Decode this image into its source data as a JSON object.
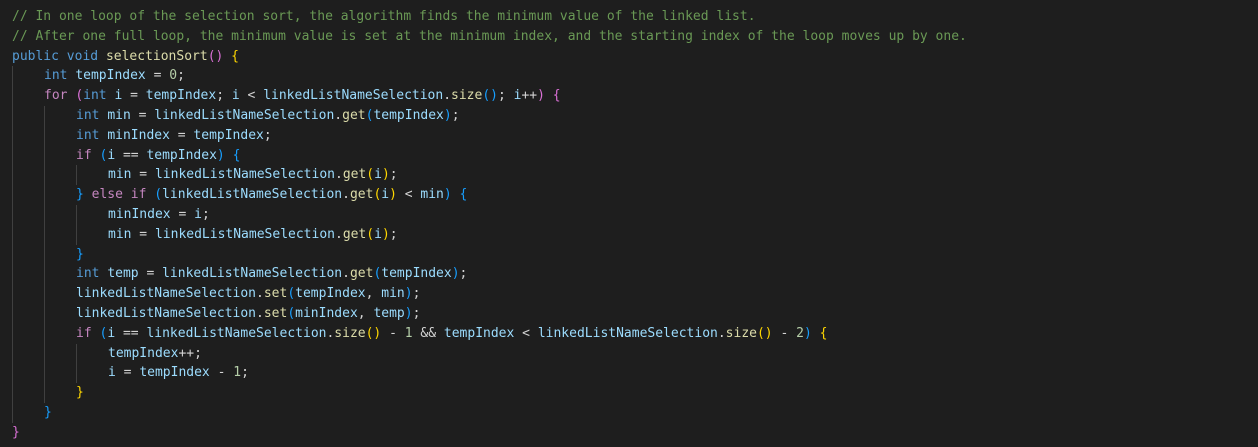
{
  "theme": {
    "background": "#1e1e1e",
    "comment": "#6a9955",
    "keyword": "#569cd6",
    "control": "#c586c0",
    "method": "#dcdcaa",
    "variable": "#9cdcfe",
    "number": "#b5cea8",
    "plain": "#d4d4d4",
    "bracket1": "#ffd700",
    "bracket2": "#da70d6",
    "bracket3": "#179fff"
  },
  "code": {
    "lines": [
      {
        "indent": 0,
        "tokens": [
          {
            "t": "// In one loop of the selection sort, the algorithm finds the minimum value of the linked list.",
            "c": "comment"
          }
        ]
      },
      {
        "indent": 0,
        "tokens": [
          {
            "t": "// After one full loop, the minimum value is set at the minimum index, and the starting index of the loop moves up by one.",
            "c": "comment"
          }
        ]
      },
      {
        "indent": 0,
        "tokens": [
          {
            "t": "public",
            "c": "keyword"
          },
          {
            "t": " ",
            "c": "plain"
          },
          {
            "t": "void",
            "c": "keyword"
          },
          {
            "t": " ",
            "c": "plain"
          },
          {
            "t": "selectionSort",
            "c": "method"
          },
          {
            "t": "()",
            "c": "bracket2"
          },
          {
            "t": " ",
            "c": "plain"
          },
          {
            "t": "{",
            "c": "bracket1"
          }
        ]
      },
      {
        "indent": 1,
        "tokens": [
          {
            "t": "int",
            "c": "keyword"
          },
          {
            "t": " ",
            "c": "plain"
          },
          {
            "t": "tempIndex",
            "c": "variable"
          },
          {
            "t": " = ",
            "c": "plain"
          },
          {
            "t": "0",
            "c": "number"
          },
          {
            "t": ";",
            "c": "plain"
          }
        ]
      },
      {
        "indent": 1,
        "tokens": [
          {
            "t": "for",
            "c": "control"
          },
          {
            "t": " ",
            "c": "plain"
          },
          {
            "t": "(",
            "c": "bracket2"
          },
          {
            "t": "int",
            "c": "keyword"
          },
          {
            "t": " ",
            "c": "plain"
          },
          {
            "t": "i",
            "c": "variable"
          },
          {
            "t": " = ",
            "c": "plain"
          },
          {
            "t": "tempIndex",
            "c": "variable"
          },
          {
            "t": "; ",
            "c": "plain"
          },
          {
            "t": "i",
            "c": "variable"
          },
          {
            "t": " < ",
            "c": "plain"
          },
          {
            "t": "linkedListNameSelection",
            "c": "variable"
          },
          {
            "t": ".",
            "c": "plain"
          },
          {
            "t": "size",
            "c": "method"
          },
          {
            "t": "()",
            "c": "bracket3"
          },
          {
            "t": "; ",
            "c": "plain"
          },
          {
            "t": "i",
            "c": "variable"
          },
          {
            "t": "++",
            "c": "plain"
          },
          {
            "t": ")",
            "c": "bracket2"
          },
          {
            "t": " ",
            "c": "plain"
          },
          {
            "t": "{",
            "c": "bracket2"
          }
        ]
      },
      {
        "indent": 2,
        "tokens": [
          {
            "t": "int",
            "c": "keyword"
          },
          {
            "t": " ",
            "c": "plain"
          },
          {
            "t": "min",
            "c": "variable"
          },
          {
            "t": " = ",
            "c": "plain"
          },
          {
            "t": "linkedListNameSelection",
            "c": "variable"
          },
          {
            "t": ".",
            "c": "plain"
          },
          {
            "t": "get",
            "c": "method"
          },
          {
            "t": "(",
            "c": "bracket3"
          },
          {
            "t": "tempIndex",
            "c": "variable"
          },
          {
            "t": ")",
            "c": "bracket3"
          },
          {
            "t": ";",
            "c": "plain"
          }
        ]
      },
      {
        "indent": 2,
        "tokens": [
          {
            "t": "int",
            "c": "keyword"
          },
          {
            "t": " ",
            "c": "plain"
          },
          {
            "t": "minIndex",
            "c": "variable"
          },
          {
            "t": " = ",
            "c": "plain"
          },
          {
            "t": "tempIndex",
            "c": "variable"
          },
          {
            "t": ";",
            "c": "plain"
          }
        ]
      },
      {
        "indent": 2,
        "tokens": [
          {
            "t": "if",
            "c": "control"
          },
          {
            "t": " ",
            "c": "plain"
          },
          {
            "t": "(",
            "c": "bracket3"
          },
          {
            "t": "i",
            "c": "variable"
          },
          {
            "t": " == ",
            "c": "plain"
          },
          {
            "t": "tempIndex",
            "c": "variable"
          },
          {
            "t": ")",
            "c": "bracket3"
          },
          {
            "t": " ",
            "c": "plain"
          },
          {
            "t": "{",
            "c": "bracket3"
          }
        ]
      },
      {
        "indent": 3,
        "tokens": [
          {
            "t": "min",
            "c": "variable"
          },
          {
            "t": " = ",
            "c": "plain"
          },
          {
            "t": "linkedListNameSelection",
            "c": "variable"
          },
          {
            "t": ".",
            "c": "plain"
          },
          {
            "t": "get",
            "c": "method"
          },
          {
            "t": "(",
            "c": "bracket1"
          },
          {
            "t": "i",
            "c": "variable"
          },
          {
            "t": ")",
            "c": "bracket1"
          },
          {
            "t": ";",
            "c": "plain"
          }
        ]
      },
      {
        "indent": 2,
        "tokens": [
          {
            "t": "}",
            "c": "bracket3"
          },
          {
            "t": " ",
            "c": "plain"
          },
          {
            "t": "else",
            "c": "control"
          },
          {
            "t": " ",
            "c": "plain"
          },
          {
            "t": "if",
            "c": "control"
          },
          {
            "t": " ",
            "c": "plain"
          },
          {
            "t": "(",
            "c": "bracket3"
          },
          {
            "t": "linkedListNameSelection",
            "c": "variable"
          },
          {
            "t": ".",
            "c": "plain"
          },
          {
            "t": "get",
            "c": "method"
          },
          {
            "t": "(",
            "c": "bracket1"
          },
          {
            "t": "i",
            "c": "variable"
          },
          {
            "t": ")",
            "c": "bracket1"
          },
          {
            "t": " < ",
            "c": "plain"
          },
          {
            "t": "min",
            "c": "variable"
          },
          {
            "t": ")",
            "c": "bracket3"
          },
          {
            "t": " ",
            "c": "plain"
          },
          {
            "t": "{",
            "c": "bracket3"
          }
        ]
      },
      {
        "indent": 3,
        "tokens": [
          {
            "t": "minIndex",
            "c": "variable"
          },
          {
            "t": " = ",
            "c": "plain"
          },
          {
            "t": "i",
            "c": "variable"
          },
          {
            "t": ";",
            "c": "plain"
          }
        ]
      },
      {
        "indent": 3,
        "tokens": [
          {
            "t": "min",
            "c": "variable"
          },
          {
            "t": " = ",
            "c": "plain"
          },
          {
            "t": "linkedListNameSelection",
            "c": "variable"
          },
          {
            "t": ".",
            "c": "plain"
          },
          {
            "t": "get",
            "c": "method"
          },
          {
            "t": "(",
            "c": "bracket1"
          },
          {
            "t": "i",
            "c": "variable"
          },
          {
            "t": ")",
            "c": "bracket1"
          },
          {
            "t": ";",
            "c": "plain"
          }
        ]
      },
      {
        "indent": 2,
        "tokens": [
          {
            "t": "}",
            "c": "bracket3"
          }
        ]
      },
      {
        "indent": 2,
        "tokens": [
          {
            "t": "int",
            "c": "keyword"
          },
          {
            "t": " ",
            "c": "plain"
          },
          {
            "t": "temp",
            "c": "variable"
          },
          {
            "t": " = ",
            "c": "plain"
          },
          {
            "t": "linkedListNameSelection",
            "c": "variable"
          },
          {
            "t": ".",
            "c": "plain"
          },
          {
            "t": "get",
            "c": "method"
          },
          {
            "t": "(",
            "c": "bracket3"
          },
          {
            "t": "tempIndex",
            "c": "variable"
          },
          {
            "t": ")",
            "c": "bracket3"
          },
          {
            "t": ";",
            "c": "plain"
          }
        ]
      },
      {
        "indent": 2,
        "tokens": [
          {
            "t": "linkedListNameSelection",
            "c": "variable"
          },
          {
            "t": ".",
            "c": "plain"
          },
          {
            "t": "set",
            "c": "method"
          },
          {
            "t": "(",
            "c": "bracket3"
          },
          {
            "t": "tempIndex",
            "c": "variable"
          },
          {
            "t": ", ",
            "c": "plain"
          },
          {
            "t": "min",
            "c": "variable"
          },
          {
            "t": ")",
            "c": "bracket3"
          },
          {
            "t": ";",
            "c": "plain"
          }
        ]
      },
      {
        "indent": 2,
        "tokens": [
          {
            "t": "linkedListNameSelection",
            "c": "variable"
          },
          {
            "t": ".",
            "c": "plain"
          },
          {
            "t": "set",
            "c": "method"
          },
          {
            "t": "(",
            "c": "bracket3"
          },
          {
            "t": "minIndex",
            "c": "variable"
          },
          {
            "t": ", ",
            "c": "plain"
          },
          {
            "t": "temp",
            "c": "variable"
          },
          {
            "t": ")",
            "c": "bracket3"
          },
          {
            "t": ";",
            "c": "plain"
          }
        ]
      },
      {
        "indent": 2,
        "tokens": [
          {
            "t": "if",
            "c": "control"
          },
          {
            "t": " ",
            "c": "plain"
          },
          {
            "t": "(",
            "c": "bracket3"
          },
          {
            "t": "i",
            "c": "variable"
          },
          {
            "t": " == ",
            "c": "plain"
          },
          {
            "t": "linkedListNameSelection",
            "c": "variable"
          },
          {
            "t": ".",
            "c": "plain"
          },
          {
            "t": "size",
            "c": "method"
          },
          {
            "t": "()",
            "c": "bracket1"
          },
          {
            "t": " - ",
            "c": "plain"
          },
          {
            "t": "1",
            "c": "number"
          },
          {
            "t": " && ",
            "c": "plain"
          },
          {
            "t": "tempIndex",
            "c": "variable"
          },
          {
            "t": " < ",
            "c": "plain"
          },
          {
            "t": "linkedListNameSelection",
            "c": "variable"
          },
          {
            "t": ".",
            "c": "plain"
          },
          {
            "t": "size",
            "c": "method"
          },
          {
            "t": "()",
            "c": "bracket1"
          },
          {
            "t": " - ",
            "c": "plain"
          },
          {
            "t": "2",
            "c": "number"
          },
          {
            "t": ")",
            "c": "bracket3"
          },
          {
            "t": " ",
            "c": "plain"
          },
          {
            "t": "{",
            "c": "bracket1"
          }
        ]
      },
      {
        "indent": 3,
        "tokens": [
          {
            "t": "tempIndex",
            "c": "variable"
          },
          {
            "t": "++;",
            "c": "plain"
          }
        ]
      },
      {
        "indent": 3,
        "tokens": [
          {
            "t": "i",
            "c": "variable"
          },
          {
            "t": " = ",
            "c": "plain"
          },
          {
            "t": "tempIndex",
            "c": "variable"
          },
          {
            "t": " - ",
            "c": "plain"
          },
          {
            "t": "1",
            "c": "number"
          },
          {
            "t": ";",
            "c": "plain"
          }
        ]
      },
      {
        "indent": 2,
        "tokens": [
          {
            "t": "}",
            "c": "bracket1"
          }
        ]
      },
      {
        "indent": 1,
        "tokens": [
          {
            "t": "}",
            "c": "bracket3"
          }
        ]
      },
      {
        "indent": 0,
        "tokens": [
          {
            "t": "}",
            "c": "bracket2"
          }
        ]
      }
    ]
  }
}
